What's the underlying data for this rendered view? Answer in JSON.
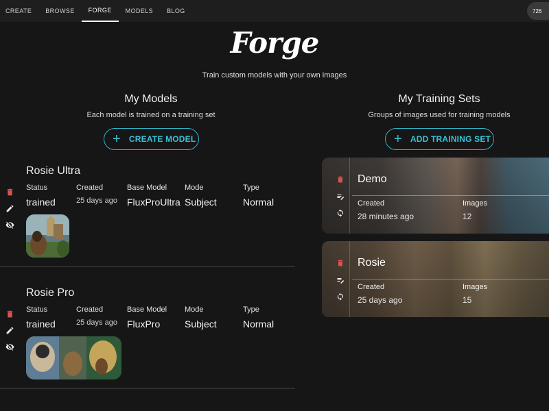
{
  "nav": {
    "items": [
      "CREATE",
      "BROWSE",
      "FORGE",
      "MODELS",
      "BLOG"
    ],
    "active": "FORGE",
    "credits": "726"
  },
  "header": {
    "logo": "Forge",
    "tagline": "Train custom models with your own images"
  },
  "my_models": {
    "title": "My Models",
    "subtitle": "Each model is trained on a training set",
    "button": "CREATE MODEL",
    "labels": {
      "status": "Status",
      "created": "Created",
      "base_model": "Base Model",
      "mode": "Mode",
      "type": "Type"
    },
    "items": [
      {
        "name": "Rosie Ultra",
        "status": "trained",
        "created": "25 days ago",
        "base_model": "FluxProUltra",
        "mode": "Subject",
        "type": "Normal"
      },
      {
        "name": "Rosie Pro",
        "status": "trained",
        "created": "25 days ago",
        "base_model": "FluxPro",
        "mode": "Subject",
        "type": "Normal"
      }
    ]
  },
  "training_sets": {
    "title": "My Training Sets",
    "subtitle": "Groups of images used for training models",
    "button": "ADD TRAINING SET",
    "labels": {
      "created": "Created",
      "images": "Images"
    },
    "items": [
      {
        "name": "Demo",
        "created": "28 minutes ago",
        "images": "12"
      },
      {
        "name": "Rosie",
        "created": "25 days ago",
        "images": "15"
      }
    ]
  },
  "icons": [
    "trash-icon",
    "pencil-icon",
    "eye-off-icon",
    "edit-list-icon",
    "sync-icon",
    "plus-icon"
  ],
  "colors": {
    "accent": "#35c2d8",
    "delete": "#d9534f",
    "background": "#161616",
    "nav": "#1e1e1e"
  }
}
